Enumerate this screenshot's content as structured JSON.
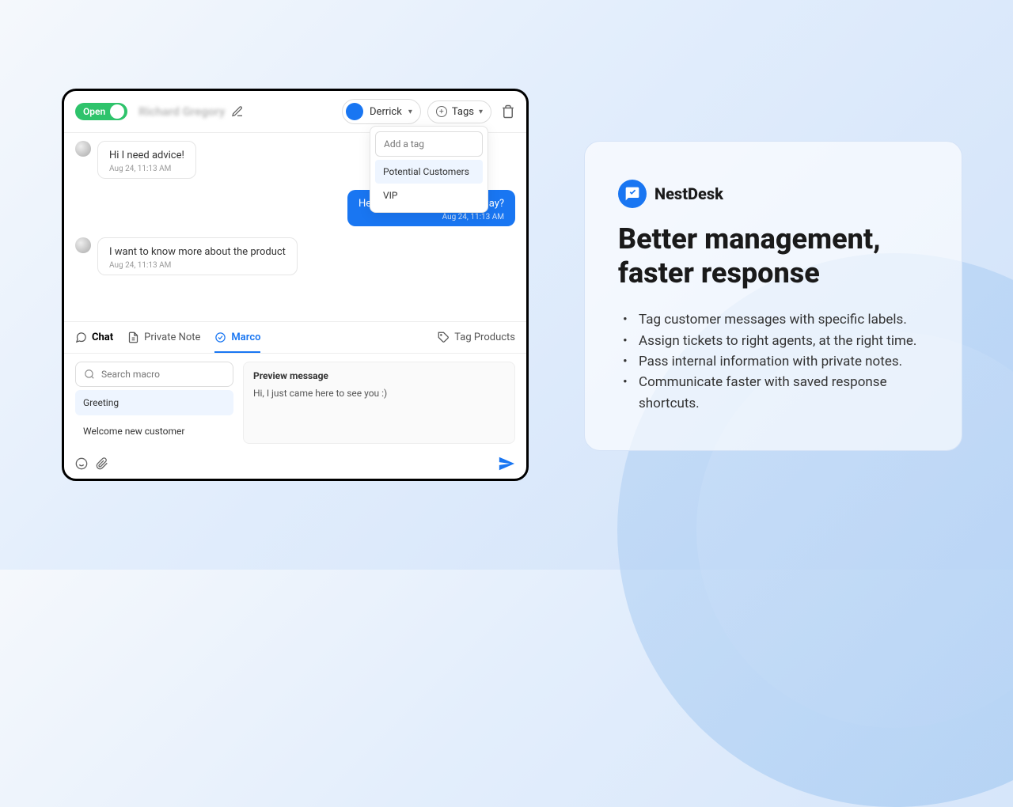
{
  "topbar": {
    "status": "Open",
    "contact_name": "Richard Gregory",
    "assignee": "Derrick",
    "tags_label": "Tags"
  },
  "tag_dropdown": {
    "placeholder": "Add a tag",
    "options": [
      "Potential Customers",
      "VIP"
    ]
  },
  "messages": [
    {
      "side": "in",
      "text": "Hi I need advice!",
      "time": "Aug 24, 11:13 AM"
    },
    {
      "side": "out",
      "text": "Hello, how can I help you today?",
      "time": "Aug 24, 11:13 AM"
    },
    {
      "side": "in",
      "text": "I want to know more about the product",
      "time": "Aug 24, 11:13 AM"
    }
  ],
  "tabs": {
    "chat": "Chat",
    "private_note": "Private Note",
    "marco": "Marco",
    "tag_products": "Tag Products"
  },
  "macro": {
    "search_placeholder": "Search macro",
    "items": [
      "Greeting",
      "Welcome new customer"
    ],
    "preview_label": "Preview message",
    "preview_text": "Hi, I just came here to see you :)"
  },
  "promo": {
    "brand": "NestDesk",
    "title_line1": "Better management,",
    "title_line2": "faster response",
    "bullets": [
      "Tag customer messages with specific labels.",
      "Assign tickets to right agents, at the right time.",
      "Pass internal information with private notes.",
      "Communicate faster with saved response shortcuts."
    ]
  }
}
